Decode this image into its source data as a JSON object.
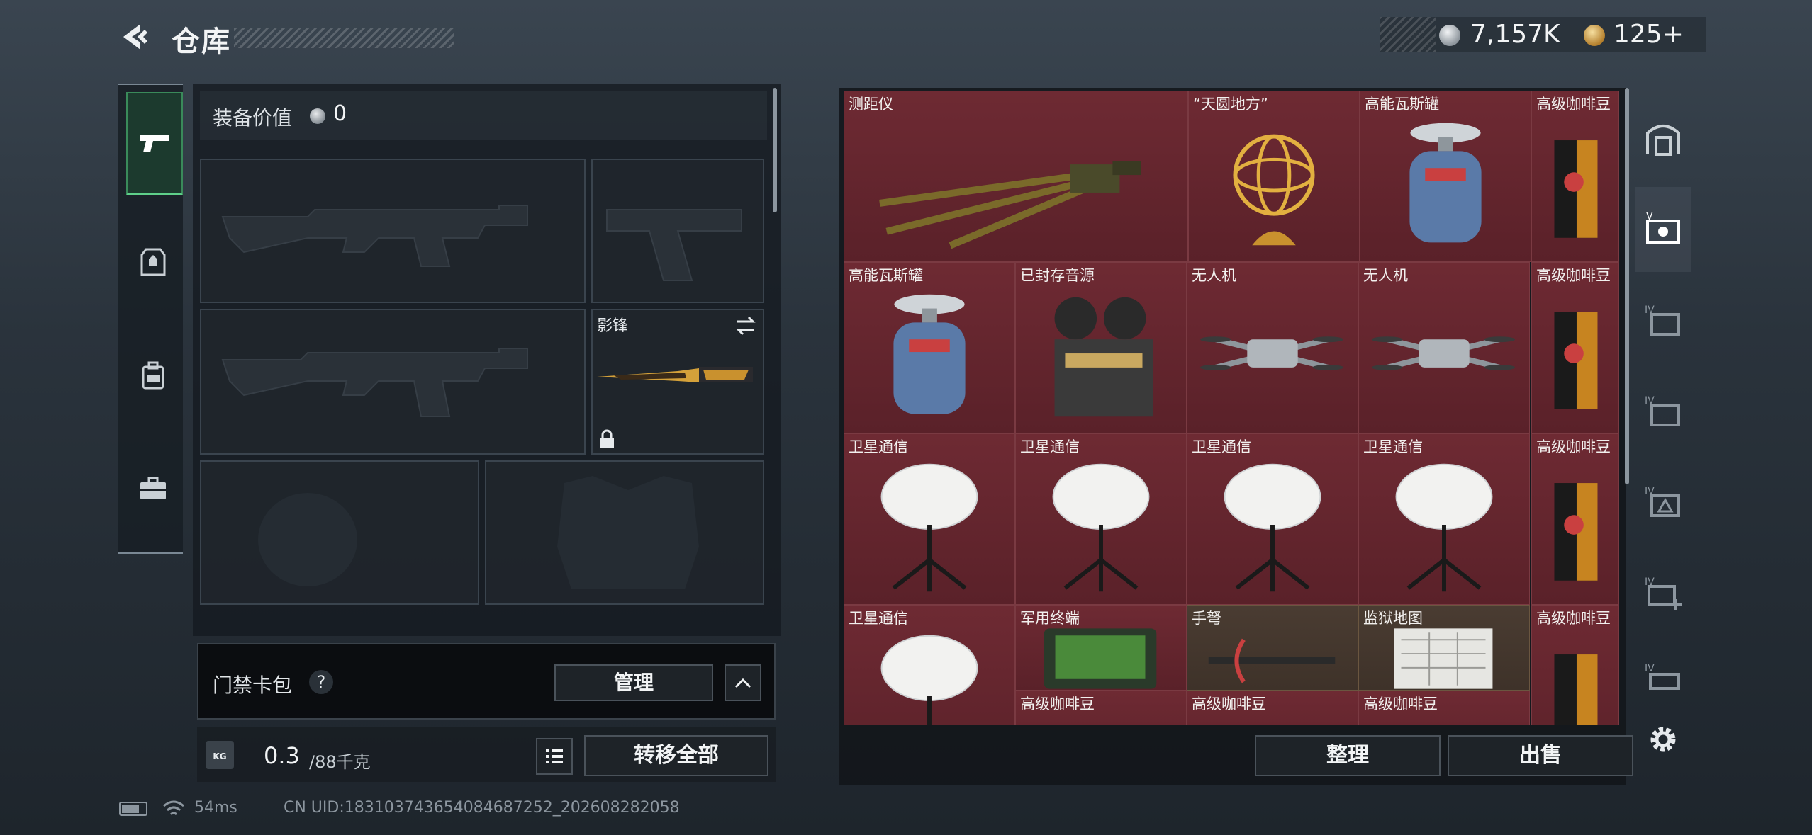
{
  "header": {
    "title": "仓库",
    "currency_silver": "7,157K",
    "currency_gold": "125+"
  },
  "equipment": {
    "value_label": "装备价值",
    "value": "0",
    "melee_name": "影锋"
  },
  "keycard": {
    "label": "门禁卡包",
    "help": "?",
    "manage_label": "管理"
  },
  "weight": {
    "current": "0.3",
    "max": "/88千克",
    "icon_text": "KG",
    "transfer_label": "转移全部"
  },
  "status": {
    "ping": "54ms",
    "uid": "CN UID:183103743654084687252_202608282058"
  },
  "stash": {
    "organize_label": "整理",
    "sell_label": "出售",
    "items": [
      {
        "label": "测距仪",
        "icon": "rangefinder-tripod-icon"
      },
      {
        "label": "“天圆地方”",
        "icon": "armillary-sphere-icon"
      },
      {
        "label": "高能瓦斯罐",
        "icon": "gas-canister-icon"
      },
      {
        "label": "高级咖啡豆",
        "icon": "coffee-bag-icon"
      },
      {
        "label": "高能瓦斯罐",
        "icon": "gas-canister-icon"
      },
      {
        "label": "已封存音源",
        "icon": "reel-tape-recorder-icon"
      },
      {
        "label": "无人机",
        "icon": "drone-icon"
      },
      {
        "label": "无人机",
        "icon": "drone-icon"
      },
      {
        "label": "高级咖啡豆",
        "icon": "coffee-bag-icon"
      },
      {
        "label": "卫星通信",
        "icon": "satellite-dish-icon"
      },
      {
        "label": "卫星通信",
        "icon": "satellite-dish-icon"
      },
      {
        "label": "卫星通信",
        "icon": "satellite-dish-icon"
      },
      {
        "label": "卫星通信",
        "icon": "satellite-dish-icon"
      },
      {
        "label": "高级咖啡豆",
        "icon": "coffee-bag-icon"
      },
      {
        "label": "卫星通信",
        "icon": "satellite-dish-icon"
      },
      {
        "label": "军用终端",
        "icon": "military-terminal-icon"
      },
      {
        "label": "手弩",
        "icon": "crossbow-icon"
      },
      {
        "label": "监狱地图",
        "icon": "prison-map-icon"
      },
      {
        "label": "高级咖啡豆",
        "icon": "coffee-bag-icon"
      },
      {
        "label": "高级咖啡豆",
        "icon": "coffee-bag-icon"
      },
      {
        "label": "高级咖啡豆",
        "icon": "coffee-bag-icon"
      },
      {
        "label": "高级咖啡豆",
        "icon": "coffee-bag-icon"
      }
    ]
  },
  "colors": {
    "rare_red": "#6e2a33",
    "accent_green": "#5fd08a",
    "gold": "#d4a13a"
  },
  "right_bar_icons": [
    "safe-box-icon",
    "container-icon",
    "container-iv-icon",
    "container-iv-icon",
    "container-warning-iv-icon",
    "container-add-iv-icon",
    "container-iv-icon"
  ]
}
